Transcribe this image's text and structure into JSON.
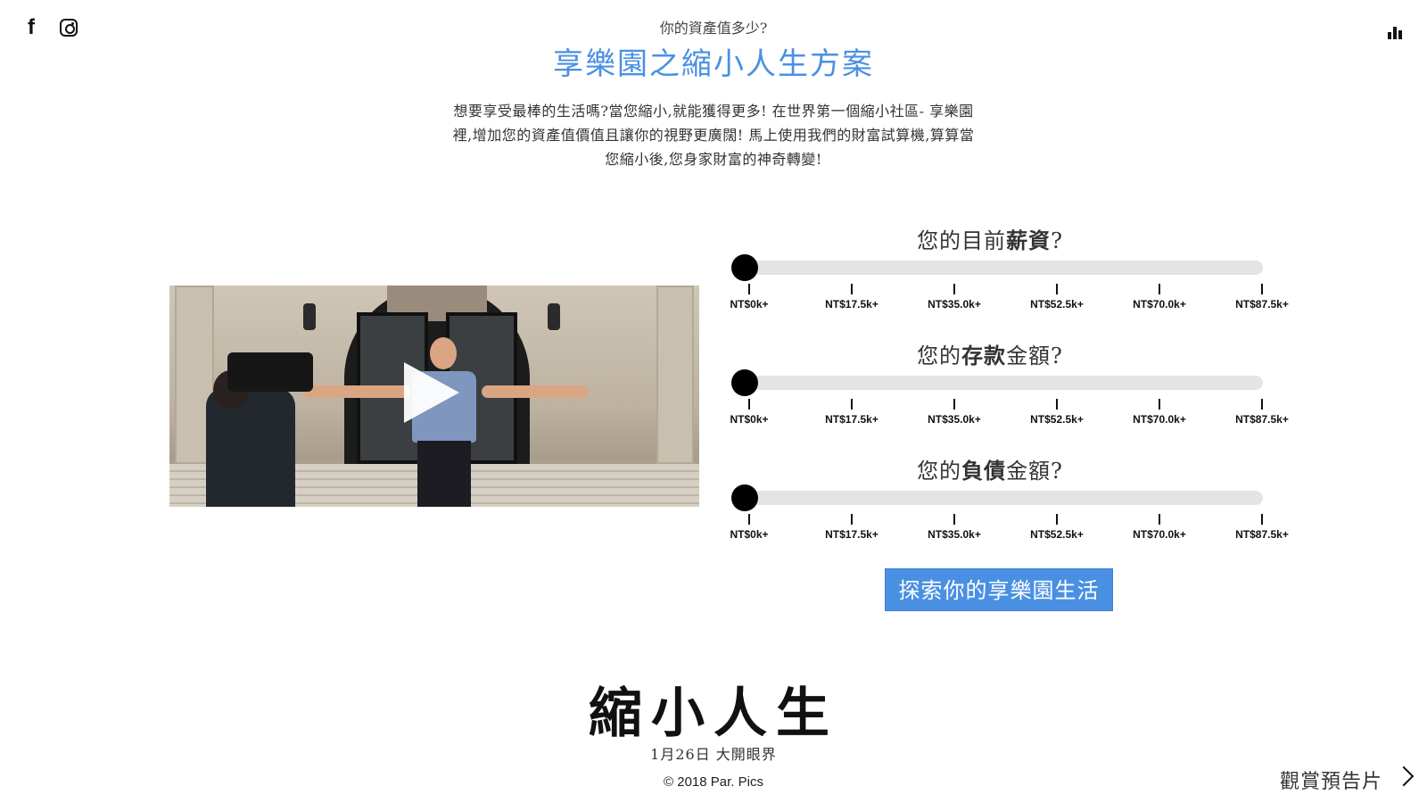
{
  "social": {
    "facebook_glyph": "f",
    "icons": [
      "facebook-icon",
      "instagram-icon"
    ]
  },
  "header": {
    "subtitle": "你的資產值多少?",
    "title": "享樂園之縮小人生方案",
    "intro_lines": [
      "想要享受最棒的生活嗎?當您縮小,就能獲得更多! 在世界第一個縮小社區- 享樂園",
      "裡,增加您的資產值價值且讓你的視野更廣闊! 馬上使用我們的財富試算機,算算當",
      "您縮小後,您身家財富的神奇轉變!"
    ]
  },
  "sliders": [
    {
      "prefix": "您的目前",
      "emphasis": "薪資",
      "suffix": "?",
      "value_fraction": 0
    },
    {
      "prefix": "您的",
      "emphasis": "存款",
      "suffix": "金額?",
      "value_fraction": 0
    },
    {
      "prefix": "您的",
      "emphasis": "負債",
      "suffix": "金額?",
      "value_fraction": 0
    }
  ],
  "tick_labels": [
    "NT$0k+",
    "NT$17.5k+",
    "NT$35.0k+",
    "NT$52.5k+",
    "NT$70.0k+",
    "NT$87.5k+"
  ],
  "cta_label": "探索你的享樂園生活",
  "footer": {
    "logo_text": "縮小人生",
    "release_date": "1月26日 大開眼界",
    "copyright": "© 2018 Par. Pics",
    "trailer_label": "觀賞預告片"
  },
  "colors": {
    "accent": "#4a90e2",
    "track": "#e4e4e4",
    "knob": "#000000"
  }
}
